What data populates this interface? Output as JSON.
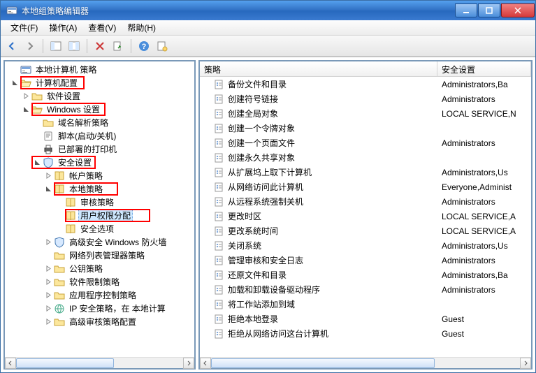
{
  "title": "本地组策略编辑器",
  "menu": {
    "file": "文件(F)",
    "action": "操作(A)",
    "view": "查看(V)",
    "help": "帮助(H)"
  },
  "tree": {
    "root": "本地计算机 策略",
    "computer_config": "计算机配置",
    "software_settings": "软件设置",
    "windows_settings": "Windows 设置",
    "dns_policy": "域名解析策略",
    "scripts": "脚本(启动/关机)",
    "printers": "已部署的打印机",
    "security_settings": "安全设置",
    "account_policies": "帐户策略",
    "local_policies": "本地策略",
    "audit_policy": "审核策略",
    "user_rights": "用户权限分配",
    "security_options": "安全选项",
    "firewall": "高级安全 Windows 防火墙",
    "network_list": "网络列表管理器策略",
    "public_key": "公钥策略",
    "software_restriction": "软件限制策略",
    "app_control": "应用程序控制策略",
    "ip_security": "IP 安全策略，在 本地计算",
    "advanced_audit": "高级审核策略配置"
  },
  "columns": {
    "policy": "策略",
    "security": "安全设置"
  },
  "rows": [
    {
      "name": "备份文件和目录",
      "value": "Administrators,Ba"
    },
    {
      "name": "创建符号链接",
      "value": "Administrators"
    },
    {
      "name": "创建全局对象",
      "value": "LOCAL SERVICE,N"
    },
    {
      "name": "创建一个令牌对象",
      "value": ""
    },
    {
      "name": "创建一个页面文件",
      "value": "Administrators"
    },
    {
      "name": "创建永久共享对象",
      "value": ""
    },
    {
      "name": "从扩展坞上取下计算机",
      "value": "Administrators,Us"
    },
    {
      "name": "从网络访问此计算机",
      "value": "Everyone,Administ"
    },
    {
      "name": "从远程系统强制关机",
      "value": "Administrators"
    },
    {
      "name": "更改时区",
      "value": "LOCAL SERVICE,A"
    },
    {
      "name": "更改系统时间",
      "value": "LOCAL SERVICE,A"
    },
    {
      "name": "关闭系统",
      "value": "Administrators,Us"
    },
    {
      "name": "管理审核和安全日志",
      "value": "Administrators"
    },
    {
      "name": "还原文件和目录",
      "value": "Administrators,Ba"
    },
    {
      "name": "加载和卸载设备驱动程序",
      "value": "Administrators"
    },
    {
      "name": "将工作站添加到域",
      "value": ""
    },
    {
      "name": "拒绝本地登录",
      "value": "Guest"
    },
    {
      "name": "拒绝从网络访问这台计算机",
      "value": "Guest"
    }
  ]
}
